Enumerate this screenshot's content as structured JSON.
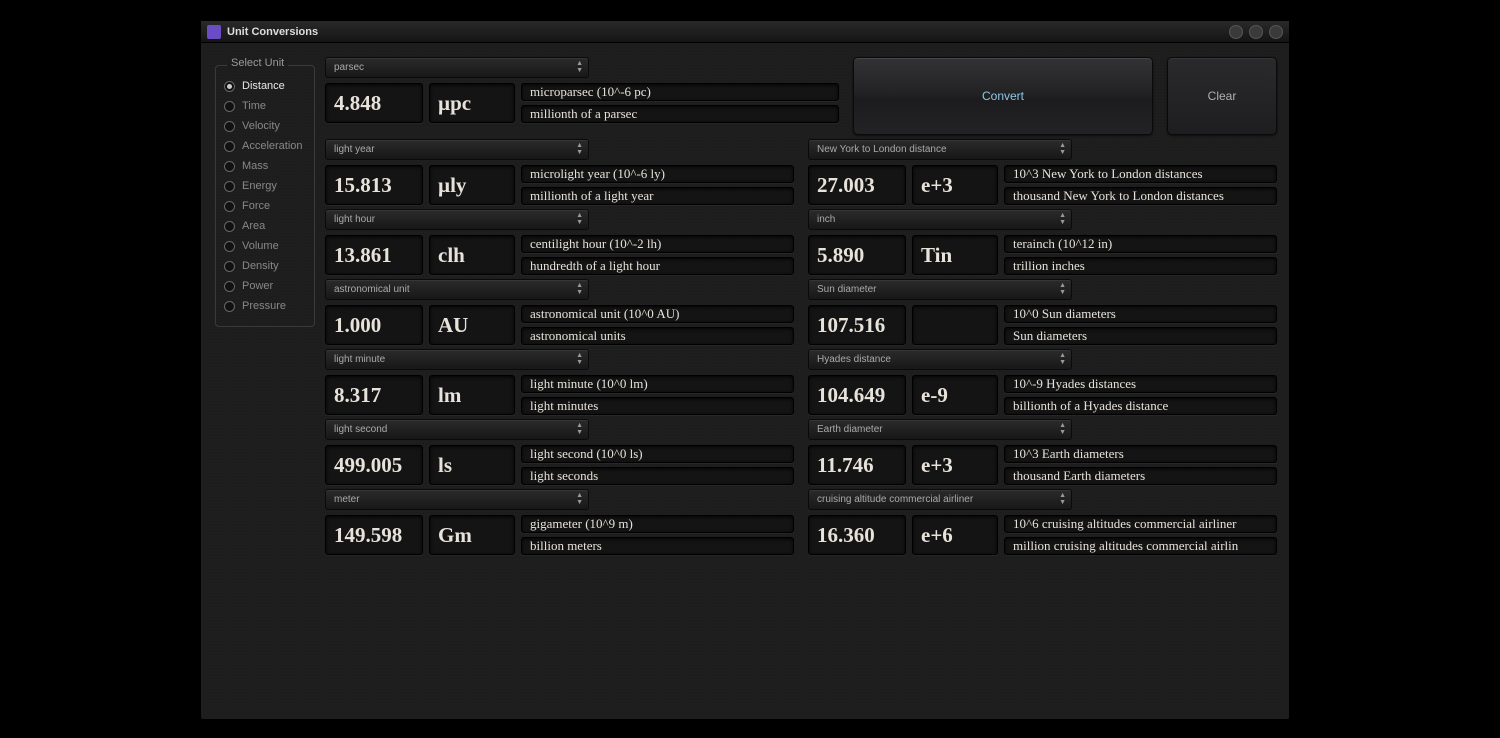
{
  "window": {
    "title": "Unit Conversions"
  },
  "sidebar": {
    "group_label": "Select Unit",
    "items": [
      {
        "label": "Distance",
        "selected": true
      },
      {
        "label": "Time",
        "selected": false
      },
      {
        "label": "Velocity",
        "selected": false
      },
      {
        "label": "Acceleration",
        "selected": false
      },
      {
        "label": "Mass",
        "selected": false
      },
      {
        "label": "Energy",
        "selected": false
      },
      {
        "label": "Force",
        "selected": false
      },
      {
        "label": "Area",
        "selected": false
      },
      {
        "label": "Volume",
        "selected": false
      },
      {
        "label": "Density",
        "selected": false
      },
      {
        "label": "Power",
        "selected": false
      },
      {
        "label": "Pressure",
        "selected": false
      }
    ]
  },
  "buttons": {
    "convert": "Convert",
    "clear": "Clear"
  },
  "left": [
    {
      "unit": "parsec",
      "value": "4.848",
      "symbol": "µpc",
      "desc1": "microparsec  (10^-6 pc)",
      "desc2": "millionth of a parsec"
    },
    {
      "unit": "light year",
      "value": "15.813",
      "symbol": "µly",
      "desc1": "microlight year  (10^-6 ly)",
      "desc2": "millionth of a light year"
    },
    {
      "unit": "light hour",
      "value": "13.861",
      "symbol": "clh",
      "desc1": "centilight hour  (10^-2 lh)",
      "desc2": "hundredth of a light hour"
    },
    {
      "unit": "astronomical unit",
      "value": "1.000",
      "symbol": "AU",
      "desc1": "astronomical unit  (10^0 AU)",
      "desc2": "astronomical units"
    },
    {
      "unit": "light minute",
      "value": "8.317",
      "symbol": "lm",
      "desc1": "light minute  (10^0 lm)",
      "desc2": "light minutes"
    },
    {
      "unit": "light second",
      "value": "499.005",
      "symbol": "ls",
      "desc1": "light second  (10^0 ls)",
      "desc2": "light seconds"
    },
    {
      "unit": "meter",
      "value": "149.598",
      "symbol": "Gm",
      "desc1": "gigameter  (10^9 m)",
      "desc2": "billion meters"
    }
  ],
  "right": [
    {
      "unit": "New York to London distance",
      "value": "27.003",
      "symbol": "e+3",
      "desc1": "10^3 New York to London distances",
      "desc2": "thousand New York to London distances"
    },
    {
      "unit": "inch",
      "value": "5.890",
      "symbol": "Tin",
      "desc1": "terainch  (10^12 in)",
      "desc2": "trillion inches"
    },
    {
      "unit": "Sun diameter",
      "value": "107.516",
      "symbol": "",
      "desc1": "10^0 Sun diameters",
      "desc2": "Sun diameters"
    },
    {
      "unit": "Hyades distance",
      "value": "104.649",
      "symbol": "e-9",
      "desc1": "10^-9 Hyades distances",
      "desc2": "billionth of a Hyades distance"
    },
    {
      "unit": "Earth diameter",
      "value": "11.746",
      "symbol": "e+3",
      "desc1": "10^3 Earth diameters",
      "desc2": "thousand Earth diameters"
    },
    {
      "unit": "cruising altitude commercial airliner",
      "value": "16.360",
      "symbol": "e+6",
      "desc1": "10^6 cruising altitudes commercial airliner",
      "desc2": "million cruising altitudes commercial airlin"
    }
  ]
}
